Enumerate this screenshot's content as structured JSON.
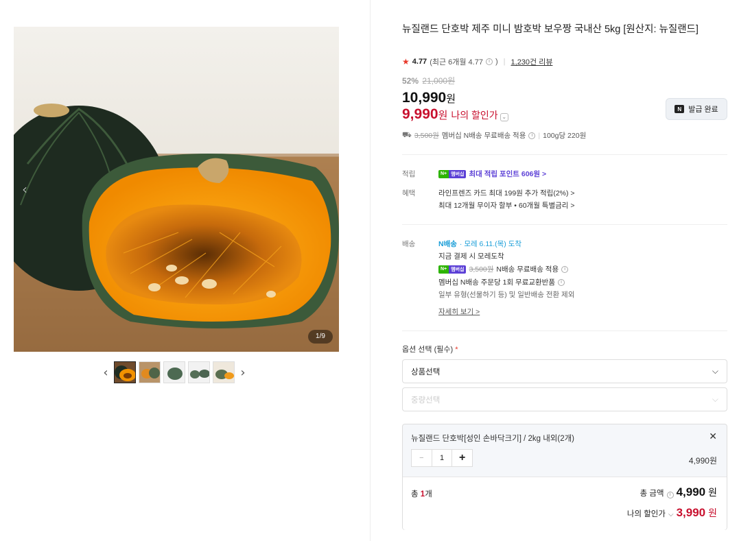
{
  "gallery": {
    "counter": "1/9",
    "prev_icon": "chevron-left-icon",
    "thumbnails": [
      "thumb-1",
      "thumb-2",
      "thumb-3",
      "thumb-4",
      "thumb-5"
    ]
  },
  "product": {
    "title": "뉴질랜드 단호박 제주 미니 밤호박 보우짱 국내산 5kg [원산지: 뉴질랜드]",
    "rating": "4.77",
    "rating_detail": "(최근 6개월 4.77",
    "rating_info": "i",
    "rating_close": ")",
    "reviews": "1,230건 리뷰",
    "discount_rate": "52%",
    "original_price": "21,000원",
    "price": "10,990",
    "price_unit": "원",
    "my_price": "9,990",
    "my_price_unit": "원",
    "my_price_label": "나의 할인가",
    "coupon_button": "발급 완료",
    "coupon_logo": "N",
    "shipping": {
      "old_fee": "3,500원",
      "text": "멤버십 N배송 무료배송 적용",
      "unit_price": "100g당 220원"
    }
  },
  "benefits": {
    "points_label": "적립",
    "points_badge_a": "N+",
    "points_badge_b": "멤버십",
    "points_text": "최대 적립 포인트 606원 >",
    "perks_label": "혜택",
    "perk_1": "라인프렌즈 카드 최대 199원 추가 적립(2%) >",
    "perk_2": "최대 12개월 무이자 할부 • 60개월 특별금리 >"
  },
  "delivery": {
    "label": "배송",
    "badge": "N배송",
    "arrival": "· 모레 6.11.(목) 도착",
    "line_1": "지금 결제 시 모레도착",
    "old_fee": "3,500원",
    "line_2": "N배송 무료배송 적용",
    "line_3": "멤버십 N배송 주문당 1회 무료교환반품",
    "line_4": "일부 유형(선물하기 등) 및 일반배송 전환 제외",
    "more": "자세히 보기 >"
  },
  "options": {
    "title": "옵션 선택 (필수)",
    "required_mark": "*",
    "select_1": "상품선택",
    "select_2": "중량선택",
    "selected_name": "뉴질랜드 단호박[성인 손바닥크기] / 2kg 내외(2개)",
    "quantity": "1",
    "item_price": "4,990원",
    "total_count_prefix": "총 ",
    "total_count_num": "1",
    "total_count_suffix": "개",
    "total_label": "총 금액",
    "total_value": "4,990",
    "total_unit": "원",
    "my_total_label": "나의 할인가",
    "my_total_value": "3,990",
    "my_total_unit": "원"
  },
  "colors": {
    "accent_red": "#c8102e",
    "membership_purple": "#5b3fd6",
    "npay_green": "#2db400"
  }
}
